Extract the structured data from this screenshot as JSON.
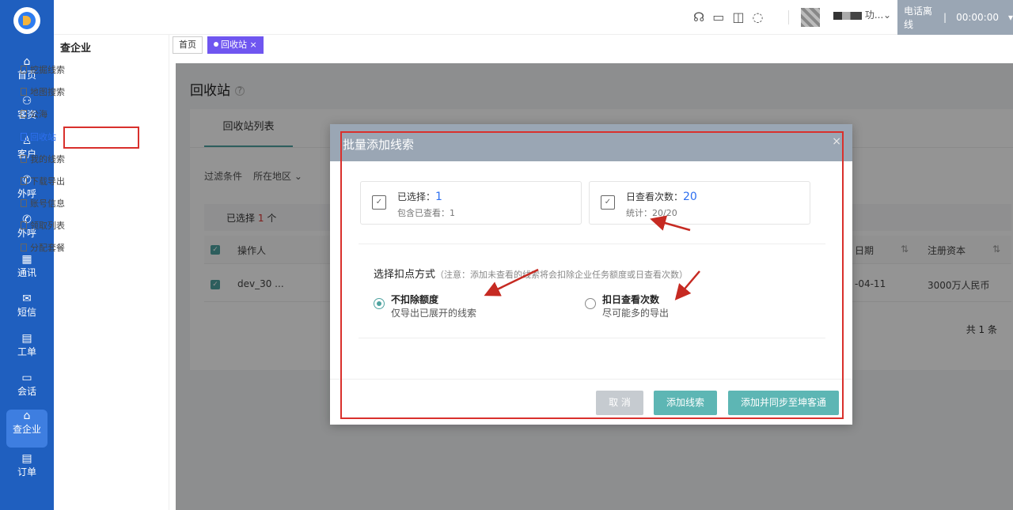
{
  "rail": {
    "items": [
      {
        "label": "首页",
        "icon": "home-icon",
        "glyph": "⌂"
      },
      {
        "label": "客资",
        "icon": "users-icon",
        "glyph": "⚇"
      },
      {
        "label": "客户",
        "icon": "user-icon",
        "glyph": "♙"
      },
      {
        "label": "外呼",
        "icon": "phone-icon",
        "glyph": "✆"
      },
      {
        "label": "外呼",
        "icon": "phone-out-icon",
        "glyph": "✆"
      },
      {
        "label": "通讯",
        "icon": "contacts-icon",
        "glyph": "▦"
      },
      {
        "label": "短信",
        "icon": "sms-icon",
        "glyph": "✉"
      },
      {
        "label": "工单",
        "icon": "clipboard-icon",
        "glyph": "▤"
      },
      {
        "label": "会话",
        "icon": "chat-icon",
        "glyph": "▭"
      },
      {
        "label": "查企业",
        "icon": "enterprise-icon",
        "glyph": "⌂"
      },
      {
        "label": "订单",
        "icon": "order-icon",
        "glyph": "▤"
      }
    ]
  },
  "topbar": {
    "icons": [
      "headset-icon",
      "monitor-icon",
      "book-icon",
      "chat-icon"
    ],
    "user_suffix": "功...",
    "call_status": "电话离线",
    "divider": "|",
    "timer": "00:00:00"
  },
  "subnav": {
    "title": "查企业",
    "items": [
      "挖掘线索",
      "地图搜索",
      "公海",
      "回收站",
      "我的线索",
      "下载导出",
      "账号信息",
      "领取列表",
      "分配套餐"
    ],
    "active": "回收站"
  },
  "tabs": {
    "home": "首页",
    "current": "回收站",
    "close": "×"
  },
  "page": {
    "title": "回收站",
    "card_tab": "回收站列表",
    "filters": {
      "label": "过滤条件",
      "region": "所在地区"
    },
    "selected_prefix": "已选择",
    "selected_count": "1",
    "selected_unit": "个",
    "columns": {
      "operator": "操作人",
      "date": "日期",
      "capital": "注册资本"
    },
    "row": {
      "operator": "dev_30 ...",
      "date": "-04-11",
      "capital": "3000万人民币"
    },
    "pager": "共 1 条"
  },
  "modal": {
    "title": "批量添加线索",
    "close": "×",
    "stat1": {
      "label": "已选择：",
      "value": "1",
      "sub": "包含已查看：1"
    },
    "stat2": {
      "label": "日查看次数：",
      "value": "20",
      "sub": "统计：20/20"
    },
    "method_title": "选择扣点方式",
    "method_note": "（注意：添加未查看的线索将会扣除企业任务额度或日查看次数）",
    "options": [
      {
        "title": "不扣除额度",
        "desc": "仅导出已展开的线索",
        "checked": true
      },
      {
        "title": "扣日查看次数",
        "desc": "尽可能多的导出",
        "checked": false
      }
    ],
    "buttons": {
      "cancel": "取 消",
      "add": "添加线索",
      "add_sync": "添加并同步至坤客通"
    }
  }
}
